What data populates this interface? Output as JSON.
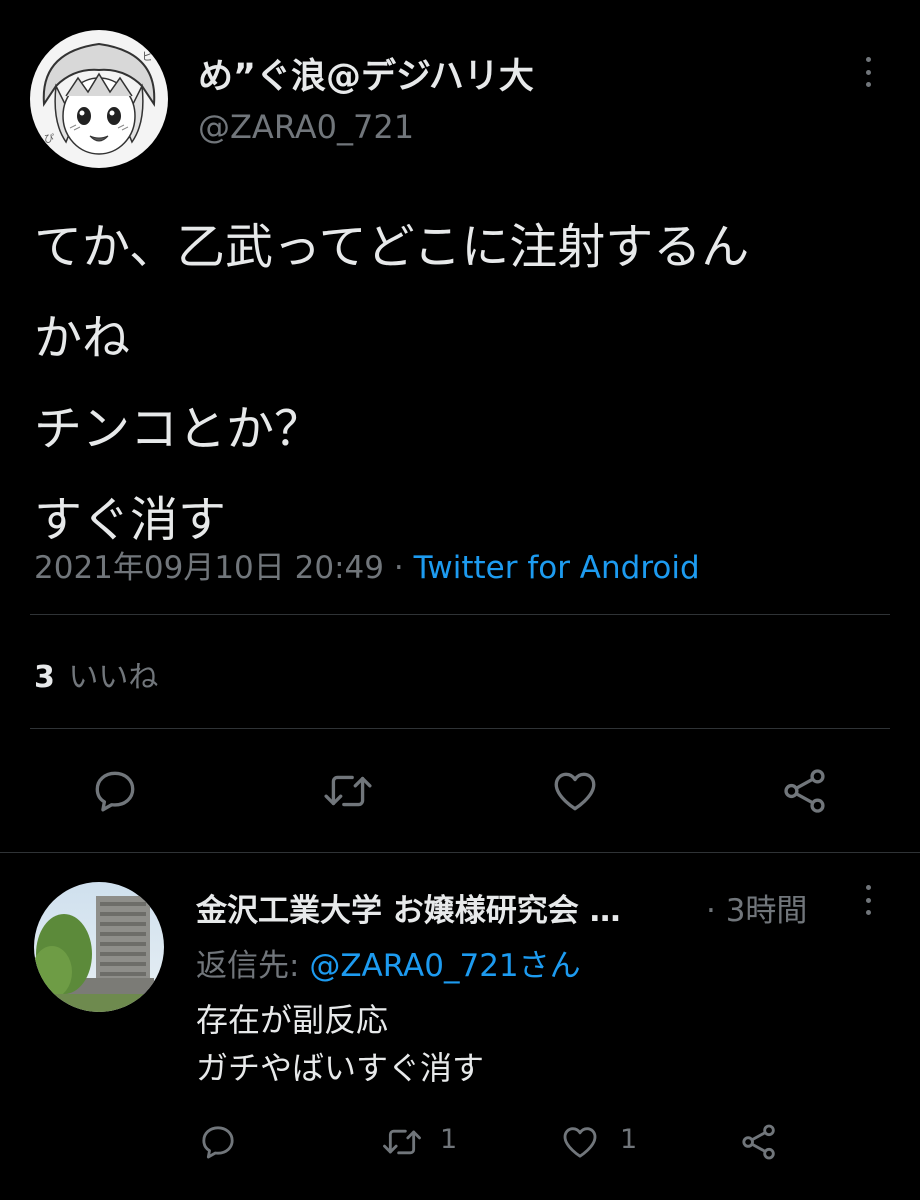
{
  "main_tweet": {
    "author_name": "め”ぐ浪@デジハリ大",
    "author_handle": "@ZARA0_721",
    "text_lines": [
      "てか、乙武ってどこに注射するん",
      "かね",
      "チンコとか？",
      "すぐ消す"
    ],
    "timestamp": "2021年09月10日 20:49",
    "separator": "·",
    "source": "Twitter for Android",
    "likes_count": "3",
    "likes_label": "いいね",
    "actions": [
      "reply-icon",
      "retweet-icon",
      "like-icon",
      "share-icon"
    ]
  },
  "reply_tweet": {
    "author_name": "金沢工業大学 お嬢様研究会 …",
    "meta": "· 3時間",
    "reply_to_label": "返信先:",
    "reply_to_handle": "@ZARA0_721さん",
    "text_lines": [
      "存在が副反応",
      "ガチやばいすぐ消す"
    ],
    "retweet_count": "1",
    "like_count": "1",
    "actions": [
      "reply-icon",
      "retweet-icon",
      "like-icon",
      "share-icon"
    ]
  },
  "colors": {
    "background": "#000000",
    "text": "#e7e9ea",
    "muted": "#71767b",
    "accent": "#1d9bf0",
    "divider": "#2f3336"
  }
}
